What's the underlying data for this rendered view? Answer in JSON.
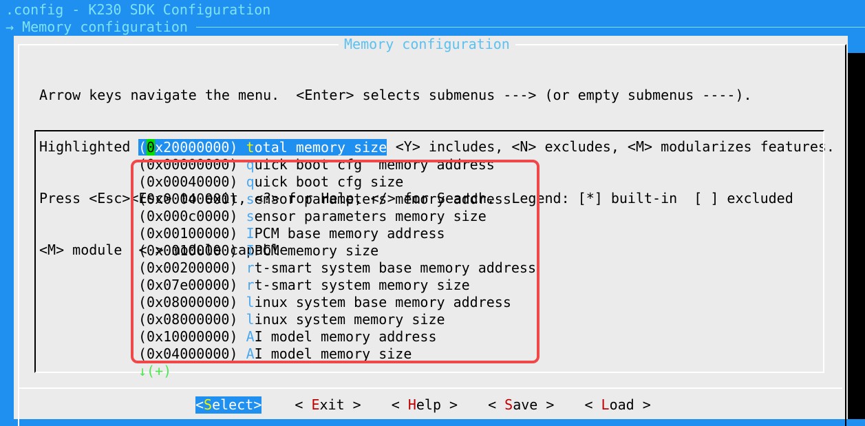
{
  "window_title": ".config - K230 SDK Configuration",
  "breadcrumb": "→ Memory configuration",
  "dialog_title": "Memory configuration",
  "help_lines": [
    "Arrow keys navigate the menu.  <Enter> selects submenus ---> (or empty submenus ----).",
    "Highlighted letters are hotkeys.  Pressing <Y> includes, <N> excludes, <M> modularizes features.",
    "Press <Esc><Esc> to exit, <?> for Help, </> for Search.  Legend: [*] built-in  [ ] excluded",
    "<M> module  < > module capable"
  ],
  "items": [
    {
      "value": "0x20000000",
      "hotkey": "t",
      "rest": "otal memory size",
      "selected": true
    },
    {
      "value": "0x00000000",
      "hotkey": "q",
      "rest": "uick boot cfg  memory address"
    },
    {
      "value": "0x00040000",
      "hotkey": "q",
      "rest": "uick boot cfg size"
    },
    {
      "value": "0x00040000",
      "hotkey": "s",
      "rest": "ensor parameters memory address"
    },
    {
      "value": "0x000c0000",
      "hotkey": "s",
      "rest": "ensor parameters memory size"
    },
    {
      "value": "0x00100000",
      "hotkey": "I",
      "rest": "PCM base memory address"
    },
    {
      "value": "0x00100000",
      "hotkey": "I",
      "rest": "PCM memory size"
    },
    {
      "value": "0x00200000",
      "hotkey": "r",
      "rest": "t-smart system base memory address"
    },
    {
      "value": "0x07e00000",
      "hotkey": "r",
      "rest": "t-smart system memory size"
    },
    {
      "value": "0x08000000",
      "hotkey": "l",
      "rest": "inux system base memory address"
    },
    {
      "value": "0x08000000",
      "hotkey": "l",
      "rest": "inux system memory size"
    },
    {
      "value": "0x10000000",
      "hotkey": "A",
      "rest": "I model memory address"
    },
    {
      "value": "0x04000000",
      "hotkey": "A",
      "rest": "I model memory size"
    }
  ],
  "more_indicator": "↓(+)",
  "buttons": [
    {
      "pre": "<",
      "key": "S",
      "rest": "elect",
      "post": ">",
      "selected": true
    },
    {
      "pre": "< ",
      "key": "E",
      "rest": "xit",
      "post": " >"
    },
    {
      "pre": "< ",
      "key": "H",
      "rest": "elp",
      "post": " >"
    },
    {
      "pre": "< ",
      "key": "S",
      "rest": "ave",
      "post": " >"
    },
    {
      "pre": "< ",
      "key": "L",
      "rest": "oad",
      "post": " >"
    }
  ],
  "colors": {
    "background": "#1f8ff0",
    "dialog": "#ebebeb",
    "hotkey": "#4aa8f0",
    "annotation": "#f04848"
  }
}
